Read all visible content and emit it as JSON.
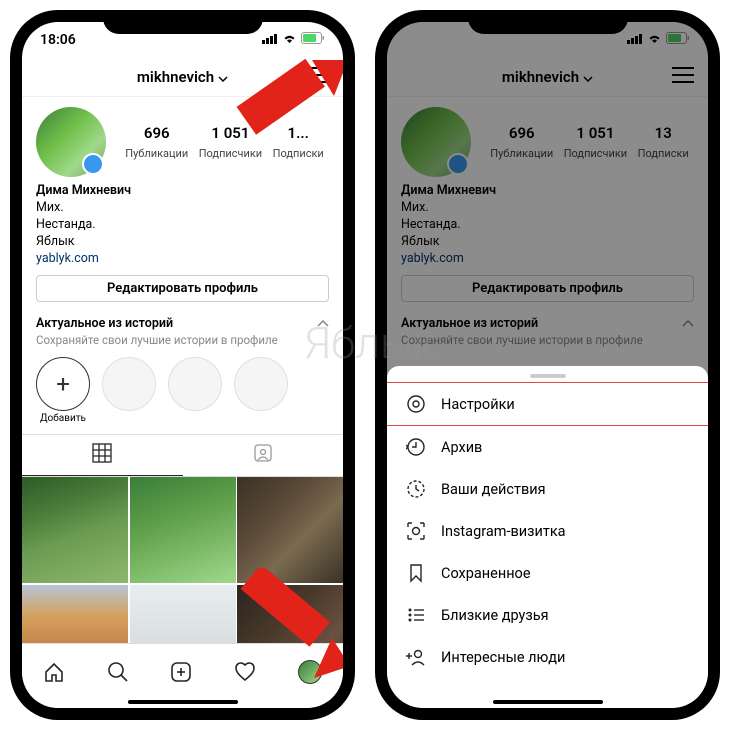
{
  "watermark": "Яблык",
  "status": {
    "time": "18:06"
  },
  "header": {
    "username": "mikhnevich"
  },
  "stats": {
    "posts": {
      "count": "696",
      "label": "Публикации"
    },
    "followers": {
      "count": "1 051",
      "label": "Подписчики"
    },
    "following": {
      "count": "13",
      "label": "Подписки"
    },
    "following_truncated": "1..."
  },
  "bio": {
    "name": "Дима Михневич",
    "line1": "Мих.",
    "line2": "Нестанда.",
    "line3": "Яблык",
    "link": "yablyk.com"
  },
  "edit_button": "Редактировать профиль",
  "highlights": {
    "title": "Актуальное из историй",
    "subtitle": "Сохраняйте свои лучшие истории в профиле",
    "add_label": "Добавить"
  },
  "sheet": {
    "settings": "Настройки",
    "archive": "Архив",
    "activity": "Ваши действия",
    "nametag": "Instagram-визитка",
    "saved": "Сохраненное",
    "close_friends": "Близкие друзья",
    "discover": "Интересные люди"
  }
}
